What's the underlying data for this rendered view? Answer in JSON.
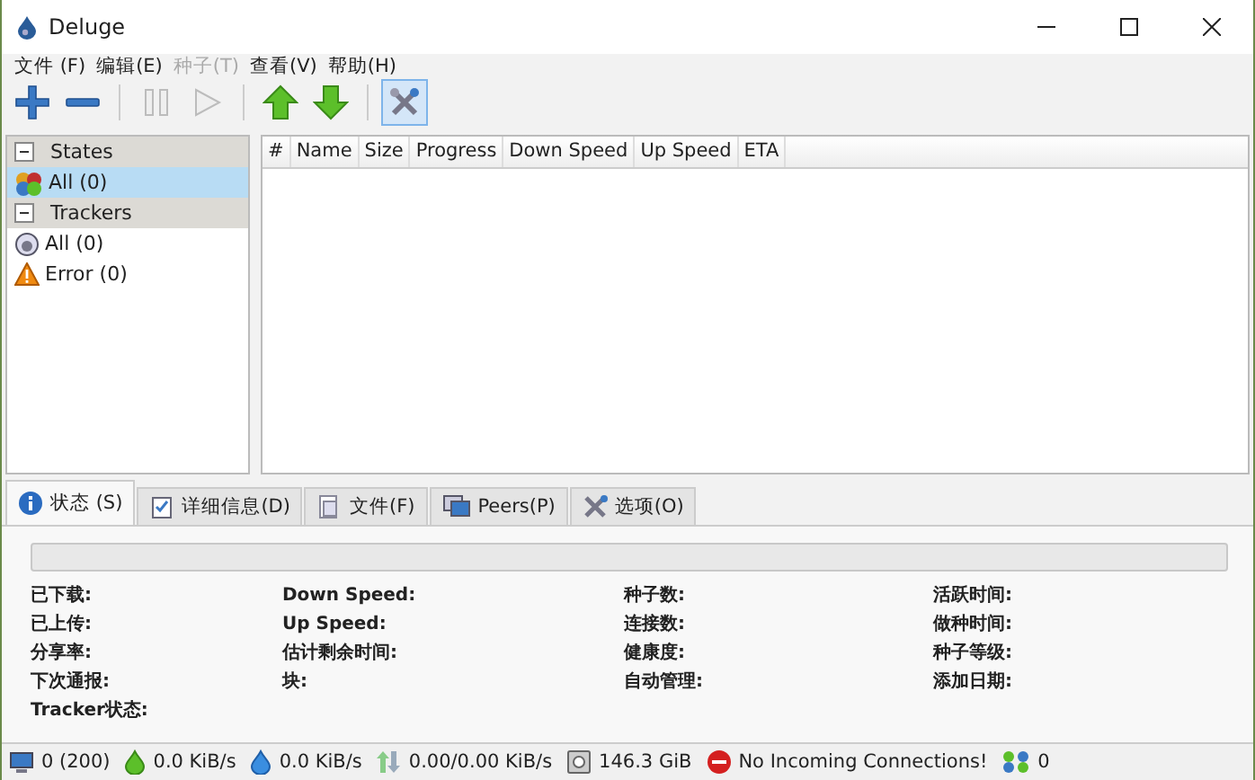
{
  "window": {
    "title": "Deluge"
  },
  "menu": [
    {
      "label": "文件 (F)",
      "disabled": false
    },
    {
      "label": "编辑(E)",
      "disabled": false
    },
    {
      "label": "种子(T)",
      "disabled": true
    },
    {
      "label": "查看(V)",
      "disabled": false
    },
    {
      "label": "帮助(H)",
      "disabled": false
    }
  ],
  "toolbar": [
    {
      "kind": "add",
      "disabled": false,
      "pressed": false
    },
    {
      "kind": "remove",
      "disabled": false,
      "pressed": false
    },
    {
      "kind": "separator"
    },
    {
      "kind": "pause",
      "disabled": true,
      "pressed": false
    },
    {
      "kind": "resume",
      "disabled": true,
      "pressed": false
    },
    {
      "kind": "separator"
    },
    {
      "kind": "up",
      "disabled": false,
      "pressed": false
    },
    {
      "kind": "down",
      "disabled": false,
      "pressed": false
    },
    {
      "kind": "separator"
    },
    {
      "kind": "preferences",
      "disabled": false,
      "pressed": true
    }
  ],
  "sidebar": {
    "groups": [
      {
        "label": "States",
        "expanded": true,
        "items": [
          {
            "kind": "states",
            "label": "All (0)",
            "selected": true
          }
        ]
      },
      {
        "label": "Trackers",
        "expanded": true,
        "items": [
          {
            "kind": "tracker",
            "label": "All (0)",
            "selected": false
          },
          {
            "kind": "error",
            "label": "Error (0)",
            "selected": false
          }
        ]
      }
    ]
  },
  "table": {
    "columns": [
      "#",
      "Name",
      "Size",
      "Progress",
      "Down Speed",
      "Up Speed",
      "ETA"
    ]
  },
  "detail_tabs": [
    {
      "kind": "info",
      "label": "状态 (S)",
      "selected": true
    },
    {
      "kind": "details",
      "label": "详细信息(D)",
      "selected": false
    },
    {
      "kind": "files",
      "label": "文件(F)",
      "selected": false
    },
    {
      "kind": "peers",
      "label": "Peers(P)",
      "selected": false
    },
    {
      "kind": "options",
      "label": "选项(O)",
      "selected": false
    }
  ],
  "status_panel": {
    "progress": {
      "level": 0
    },
    "columns": [
      [
        "已下载:",
        "已上传:",
        "分享率:",
        "下次通报:",
        "Tracker状态:"
      ],
      [
        "Down Speed:",
        "Up Speed:",
        "估计剩余时间:",
        "块:"
      ],
      [
        "种子数:",
        "连接数:",
        "健康度:",
        "自动管理:"
      ],
      [
        "活跃时间:",
        "做种时间:",
        "种子等级:",
        "添加日期:"
      ]
    ]
  },
  "status_bar": [
    {
      "kind": "connections",
      "text": "0 (200)"
    },
    {
      "kind": "download",
      "text": "0.0 KiB/s"
    },
    {
      "kind": "upload",
      "text": "0.0 KiB/s"
    },
    {
      "kind": "protocol",
      "text": "0.00/0.00 KiB/s"
    },
    {
      "kind": "disk",
      "text": "146.3 GiB"
    },
    {
      "kind": "network",
      "text": "No Incoming Connections!"
    },
    {
      "kind": "dht",
      "text": "0"
    }
  ]
}
